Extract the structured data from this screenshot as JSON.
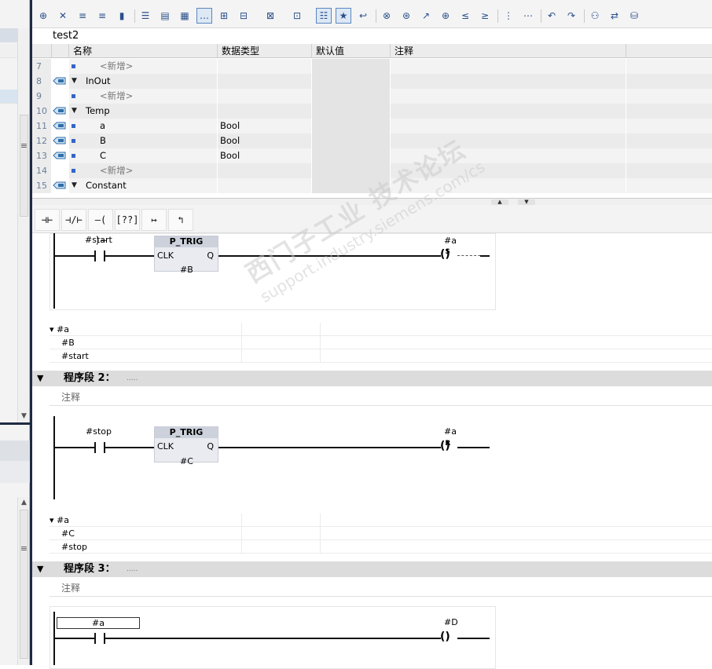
{
  "block_title": "test2",
  "toolbar": {
    "icons": [
      "insert-row-icon",
      "delete-row-icon",
      "insert-network-icon",
      "delete-network-icon",
      "stamp-icon",
      "network-list-icon",
      "open-all-networks-icon",
      "close-all-networks-icon",
      "comment-icon",
      "absolute-ops-icon",
      "favorites-icon",
      "move-down-icon",
      "sort-icon",
      "show-hide-icon",
      "favorites-star-icon",
      "go-to-icon",
      "error-next-icon",
      "monitor-icon",
      "call-icon",
      "insert-call-icon",
      "next-error-icon",
      "prev-error-icon",
      "indent-icon",
      "outdent-icon",
      "undo-icon",
      "redo-icon",
      "monitoring-icon",
      "compare-icon",
      "database-icon"
    ]
  },
  "interface": {
    "columns": [
      "名称",
      "数据类型",
      "默认值",
      "注释"
    ],
    "rows": [
      {
        "num": "7",
        "icon": "",
        "expander": "",
        "name": "<新增>",
        "type": "",
        "indent": 2,
        "placeholder": true
      },
      {
        "num": "8",
        "icon": "inout",
        "expander": "▼",
        "name": "InOut",
        "type": "",
        "indent": 0,
        "placeholder": false
      },
      {
        "num": "9",
        "icon": "",
        "expander": "",
        "name": "<新增>",
        "type": "",
        "indent": 2,
        "placeholder": true
      },
      {
        "num": "10",
        "icon": "temp",
        "expander": "▼",
        "name": "Temp",
        "type": "",
        "indent": 0,
        "placeholder": false
      },
      {
        "num": "11",
        "icon": "temp",
        "expander": "",
        "name": "a",
        "type": "Bool",
        "indent": 1,
        "placeholder": false
      },
      {
        "num": "12",
        "icon": "temp",
        "expander": "",
        "name": "B",
        "type": "Bool",
        "indent": 1,
        "placeholder": false
      },
      {
        "num": "13",
        "icon": "temp",
        "expander": "",
        "name": "C",
        "type": "Bool",
        "indent": 1,
        "placeholder": false
      },
      {
        "num": "14",
        "icon": "",
        "expander": "",
        "name": "<新增>",
        "type": "",
        "indent": 2,
        "placeholder": true
      },
      {
        "num": "15",
        "icon": "const",
        "expander": "▼",
        "name": "Constant",
        "type": "",
        "indent": 0,
        "placeholder": false
      }
    ]
  },
  "ladder_toolbar": [
    "⊣⊢",
    "⊣/⊢",
    "–( )–",
    "[??]",
    "↦",
    "↰"
  ],
  "networks": [
    {
      "contact_op": "#start",
      "fb_title": "P_TRIG",
      "fb_clk": "CLK",
      "fb_q": "Q",
      "fb_op": "#B",
      "coil_op": "#a",
      "coil_sym": "S",
      "operands": [
        {
          "name": "▾ #a"
        },
        {
          "name": "#B"
        },
        {
          "name": "#start"
        }
      ]
    },
    {
      "header": "程序段 2：",
      "header_dots": ".....",
      "comment": "注释",
      "contact_op": "#stop",
      "fb_title": "P_TRIG",
      "fb_clk": "CLK",
      "fb_q": "Q",
      "fb_op": "#C",
      "coil_op": "#a",
      "coil_sym": "R",
      "operands": [
        {
          "name": "▾ #a"
        },
        {
          "name": "#C"
        },
        {
          "name": "#stop"
        }
      ]
    },
    {
      "header": "程序段 3：",
      "header_dots": ".....",
      "comment": "注释",
      "contact_op": "#a",
      "coil_op": "#D",
      "coil_sym": " "
    }
  ],
  "watermark": {
    "line1": "西门子工业 技术论坛",
    "line2": "support.industry.siemens.com/cs"
  }
}
